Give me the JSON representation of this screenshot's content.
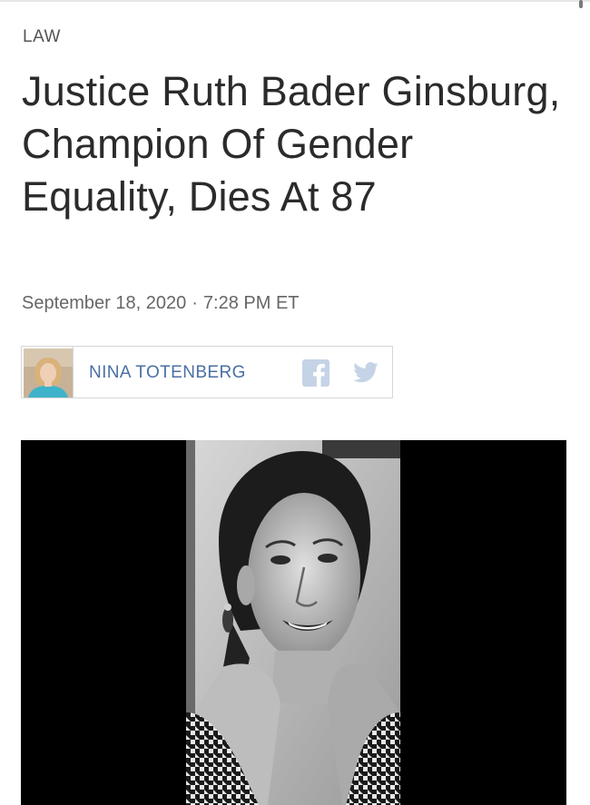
{
  "article": {
    "section": "LAW",
    "headline": "Justice Ruth Bader Ginsburg, Champion Of Gender Equality, Dies At 87",
    "date": "September 18, 2020",
    "separator": "·",
    "time": "7:28 PM ET"
  },
  "byline": {
    "author": "NINA TOTENBERG",
    "avatar_icon": "author-avatar",
    "social": [
      {
        "name": "facebook",
        "icon": "facebook-icon",
        "color": "#c5d3e6"
      },
      {
        "name": "twitter",
        "icon": "twitter-icon",
        "color": "#c5d3e6"
      }
    ]
  },
  "lead_image": {
    "subject": "black-and-white portrait photo",
    "frame_color": "#000000"
  },
  "colors": {
    "author_link": "#4a6fa5",
    "headline": "#2b2b2b",
    "meta": "#666666"
  }
}
